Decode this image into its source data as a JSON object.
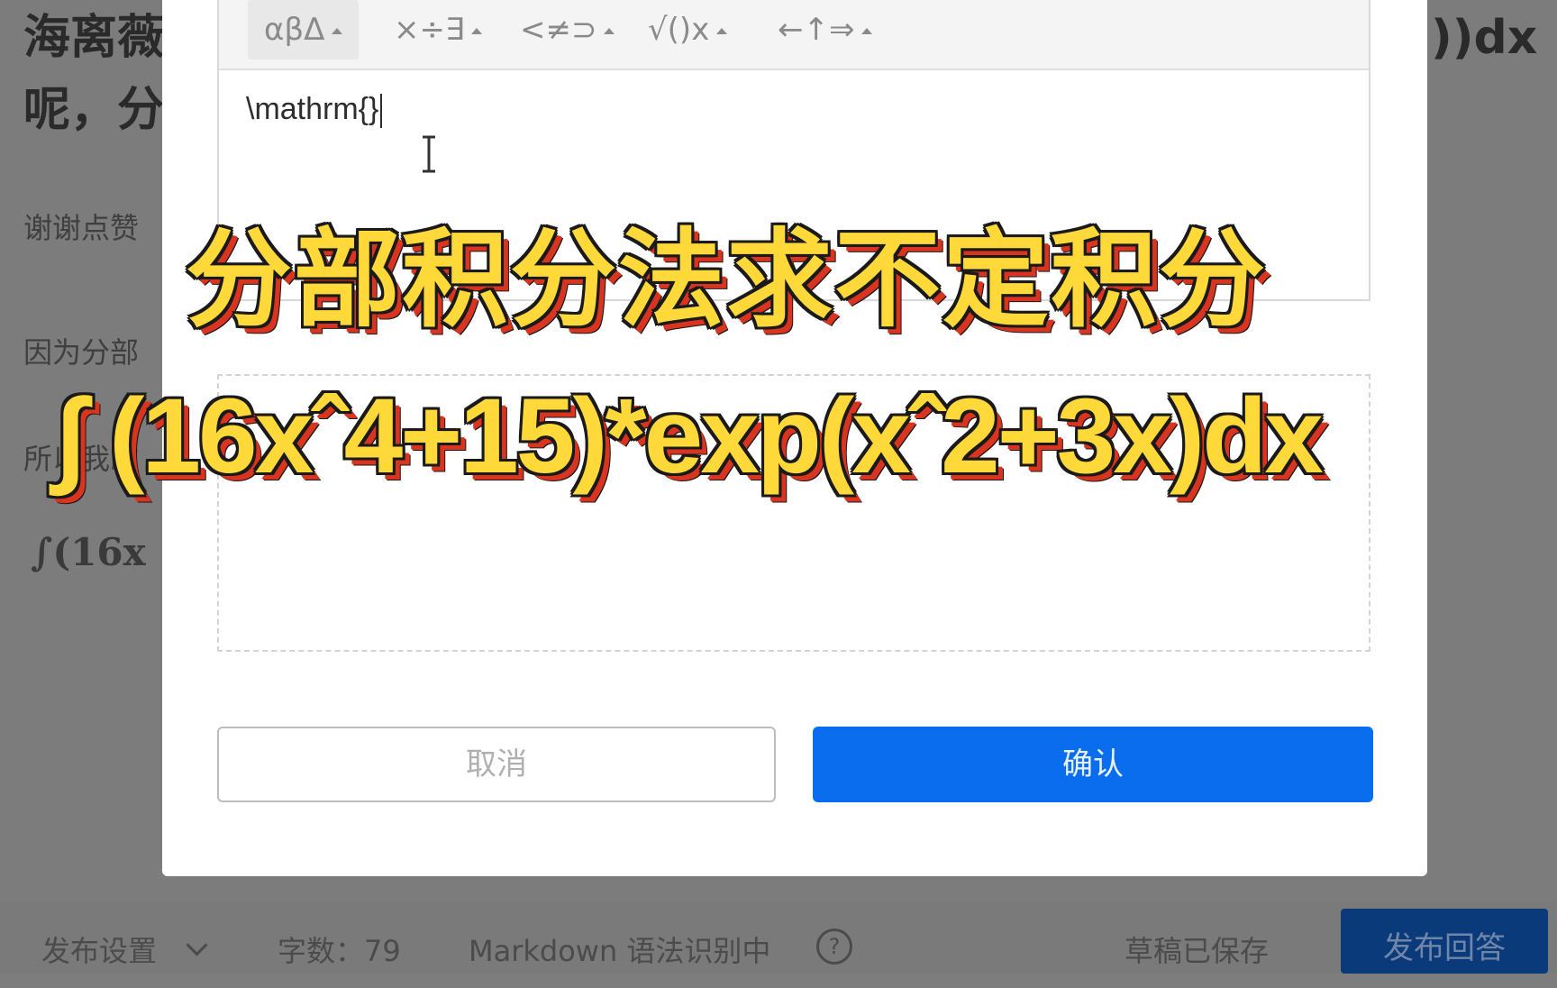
{
  "background": {
    "title_line1": "海离薇",
    "title_line1_right": "))dx",
    "title_line2": "呢，分",
    "line_thanks": "谢谢点赞",
    "line_because": "因为分部",
    "line_so": "所以我改",
    "formula_fragment": "∫(16x"
  },
  "bottom_bar": {
    "publish_settings": "发布设置",
    "word_count": "字数：79",
    "markdown_status": "Markdown 语法识别中",
    "help_icon": "?",
    "draft_saved": "草稿已保存",
    "publish_button": "发布回答"
  },
  "formula_dialog": {
    "toolbar": [
      {
        "label": "αβΔ",
        "icon": "greek-letters-icon"
      },
      {
        "label": "×÷∃",
        "icon": "operators-icon"
      },
      {
        "label": "<≠⊃",
        "icon": "relations-icon"
      },
      {
        "label": "√()x",
        "icon": "structures-icon"
      },
      {
        "label": "←↑⇒",
        "icon": "arrows-icon"
      }
    ],
    "input_value": "\\mathrm{}",
    "cancel_label": "取消",
    "confirm_label": "确认"
  },
  "overlay": {
    "caption_title": "分部积分法求不定积分",
    "caption_formula": "∫ (16xˆ4+15)*exp(xˆ2+3x)dx"
  },
  "colors": {
    "confirm_blue": "#0a6ded",
    "caption_yellow": "#ffd93a",
    "caption_shadow_red": "#d9341f",
    "overlay_gray": "#7c7c7c"
  }
}
